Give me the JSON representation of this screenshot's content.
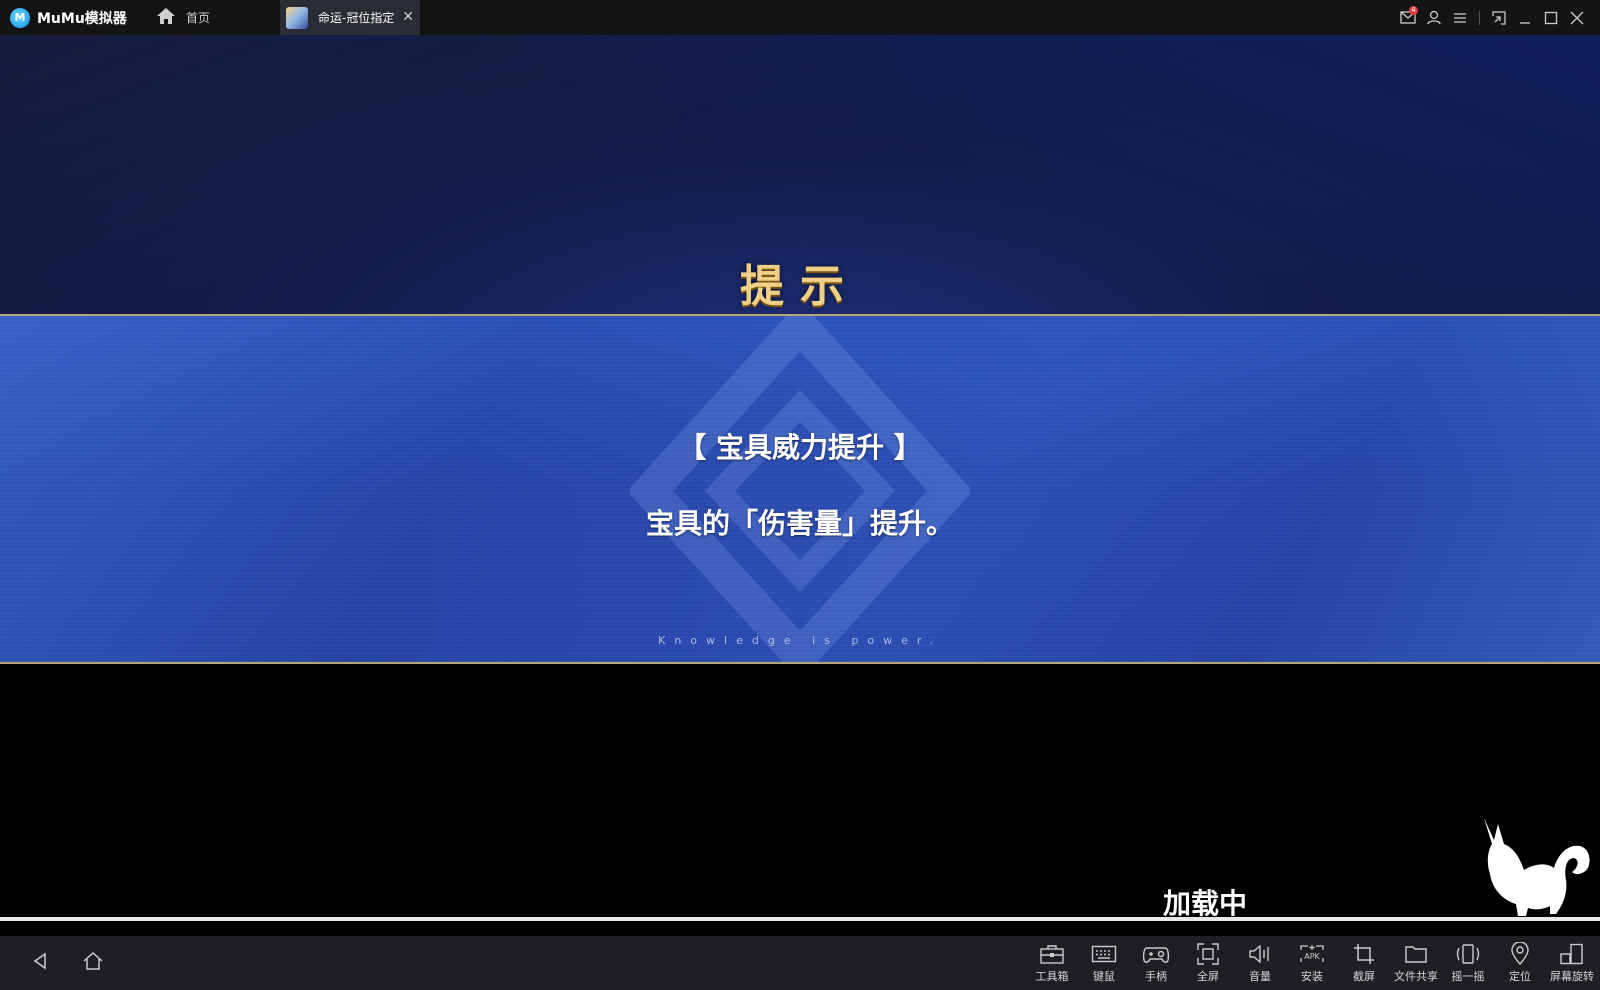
{
  "titlebar": {
    "app_name": "MuMu模拟器",
    "logo_letter": "M",
    "home_tab_label": "首页",
    "game_tab_label": "命运-冠位指定",
    "mail_badge": "4"
  },
  "game": {
    "hint_title": "提示",
    "banner_line1": "【 宝具威力提升 】",
    "banner_line2": "宝具的「伤害量」提升。",
    "motto": "Knowledge is power.",
    "loading_label": "加载中"
  },
  "toolbar": {
    "tools": [
      {
        "label": "工具箱",
        "icon": "toolbox-icon"
      },
      {
        "label": "键鼠",
        "icon": "keyboard-icon"
      },
      {
        "label": "手柄",
        "icon": "gamepad-icon"
      },
      {
        "label": "全屏",
        "icon": "fullscreen-icon"
      },
      {
        "label": "音量",
        "icon": "volume-icon"
      },
      {
        "label": "安装",
        "icon": "apk-install-icon"
      },
      {
        "label": "截屏",
        "icon": "crop-screenshot-icon"
      },
      {
        "label": "文件共享",
        "icon": "folder-icon"
      },
      {
        "label": "摇一摇",
        "icon": "shake-icon"
      },
      {
        "label": "定位",
        "icon": "location-pin-icon"
      },
      {
        "label": "屏幕旋转",
        "icon": "rotate-screen-icon"
      }
    ]
  },
  "colors": {
    "titlebar_bg": "#141416",
    "active_tab_bg": "#2a2c33",
    "banner_blue": "#2a4fb4",
    "title_gold": "#f0cf86",
    "toolbar_bg": "#1d1f24"
  }
}
